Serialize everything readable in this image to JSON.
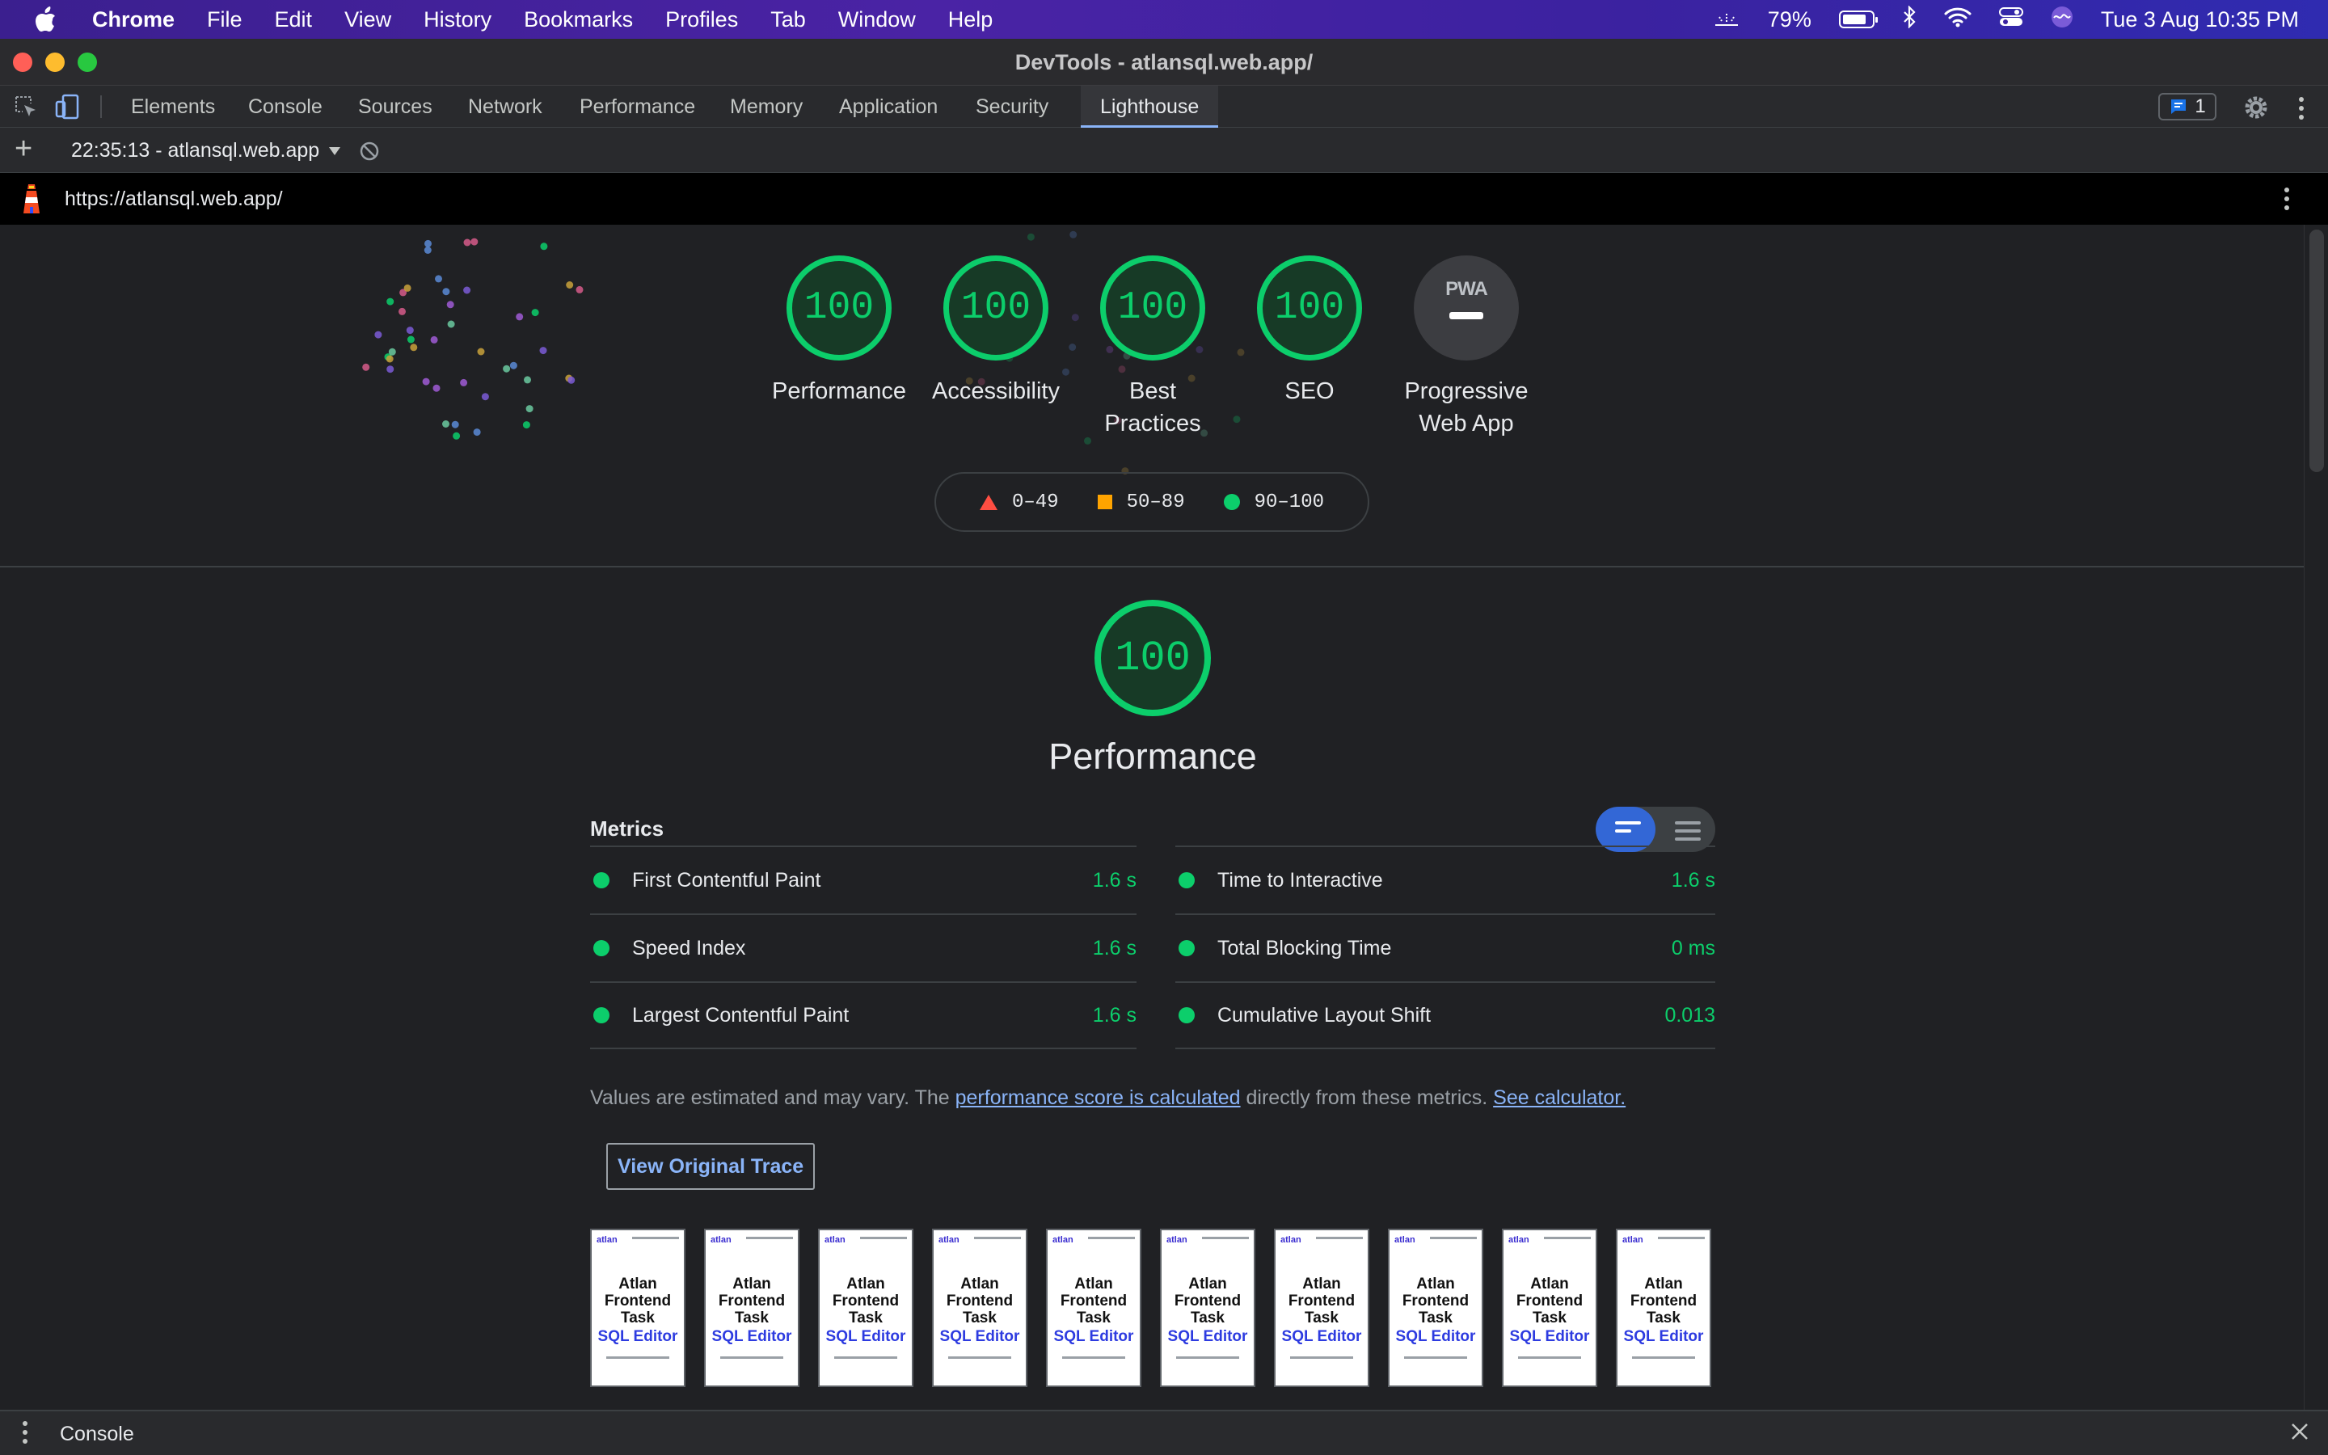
{
  "menubar": {
    "app_name": "Chrome",
    "menus": [
      "File",
      "Edit",
      "View",
      "History",
      "Bookmarks",
      "Profiles",
      "Tab",
      "Window",
      "Help"
    ],
    "battery": "79%",
    "datetime": "Tue 3 Aug  10:35 PM"
  },
  "window": {
    "title": "DevTools - atlansql.web.app/"
  },
  "devtools": {
    "tabs": [
      "Elements",
      "Console",
      "Sources",
      "Network",
      "Performance",
      "Memory",
      "Application",
      "Security",
      "Lighthouse"
    ],
    "active_tab": "Lighthouse",
    "issues_count": "1"
  },
  "lighthouse": {
    "report_select": "22:35:13 - atlansql.web.app",
    "url": "https://atlansql.web.app/"
  },
  "summary": {
    "categories": [
      {
        "label": "Performance",
        "score": "100"
      },
      {
        "label": "Accessibility",
        "score": "100"
      },
      {
        "label": "Best Practices",
        "score": "100"
      },
      {
        "label": "SEO",
        "score": "100"
      },
      {
        "label": "Progressive Web App",
        "badge": "PWA"
      }
    ],
    "legend": [
      "0–49",
      "50–89",
      "90–100"
    ]
  },
  "performance": {
    "score": "100",
    "title": "Performance",
    "metrics_heading": "Metrics",
    "metrics_left": [
      {
        "name": "First Contentful Paint",
        "value": "1.6 s"
      },
      {
        "name": "Speed Index",
        "value": "1.6 s"
      },
      {
        "name": "Largest Contentful Paint",
        "value": "1.6 s"
      }
    ],
    "metrics_right": [
      {
        "name": "Time to Interactive",
        "value": "1.6 s"
      },
      {
        "name": "Total Blocking Time",
        "value": "0 ms"
      },
      {
        "name": "Cumulative Layout Shift",
        "value": "0.013"
      }
    ],
    "note_prefix": "Values are estimated and may vary. The ",
    "note_link": "performance score is calculated",
    "note_middle": " directly from these metrics. ",
    "note_calc_link": "See calculator.",
    "trace_button": "View Original Trace",
    "filmstrip": {
      "brand": "atlan",
      "title_lines": [
        "Atlan",
        "Frontend",
        "Task"
      ],
      "subtitle": "SQL Editor"
    }
  },
  "colors": {
    "pass": "#0cce6b",
    "average": "#ffa400",
    "fail": "#ff4e42",
    "link": "#8ab4f8"
  },
  "drawer": {
    "label": "Console"
  }
}
